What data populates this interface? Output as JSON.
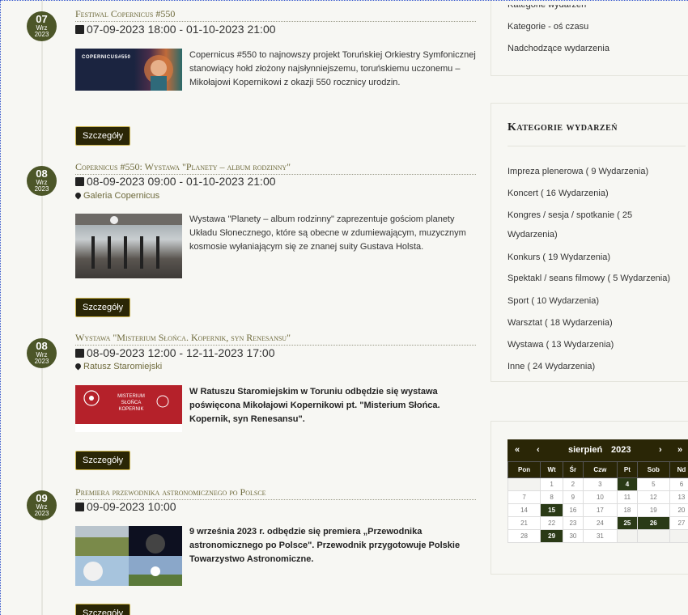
{
  "events": [
    {
      "day": "07",
      "month": "Wrz",
      "year": "2023",
      "title": "Festiwal Copernicus #550",
      "date": "07-09-2023  18:00 - 01-10-2023  21:00",
      "location": "",
      "description": "Copernicus #550 to najnowszy projekt Toruńskiej Orkiestry Symfonicznej stanowiący hołd złożony najsłynniejszemu, toruńskiemu uczonemu – Mikołajowi Kopernikowi z okazji 550 rocznicy urodzin.",
      "thumb_text": "COPERNICUS#550",
      "details_label": "Szczegóły"
    },
    {
      "day": "08",
      "month": "Wrz",
      "year": "2023",
      "title": "Copernicus #550: Wystawa \"Planety – album rodzinny\"",
      "date": "08-09-2023  09:00 - 01-10-2023  21:00",
      "location": "Galeria Copernicus",
      "description": "Wystawa \"Planety – album rodzinny\" zaprezentuje gościom planety Układu Słonecznego, które są obecne w zdumiewającym, muzycznym kosmosie wyłaniającym się ze znanej suity Gustava Holsta.",
      "details_label": "Szczegóły"
    },
    {
      "day": "08",
      "month": "Wrz",
      "year": "2023",
      "title": "Wystawa \"Misterium Słońca. Kopernik, syn Renesansu\"",
      "date": "08-09-2023  12:00 - 12-11-2023  17:00",
      "location": "Ratusz Staromiejski",
      "description": "W Ratuszu Staromiejskim w Toruniu odbędzie się wystawa poświęcona Mikołajowi Kopernikowi pt. \"Misterium Słońca. Kopernik, syn Renesansu\".",
      "thumb_text": "MISTERIUM SŁOŃCA KOPERNIK",
      "details_label": "Szczegóły"
    },
    {
      "day": "09",
      "month": "Wrz",
      "year": "2023",
      "title": "Premiera przewodnika astronomicznego po Polsce",
      "date": "09-09-2023  10:00",
      "location": "",
      "description": "9 września 2023 r. odbędzie się premiera „Przewodnika astronomicznego po Polsce\". Przewodnik przygotowuje Polskie Towarzystwo Astronomiczne.",
      "details_label": "Szczegóły"
    }
  ],
  "sidebar": {
    "top_links": [
      "Kategorie wydarzeń",
      "Kategorie - oś czasu",
      "Nadchodzące wydarzenia"
    ],
    "categories_title": "Kategorie wydarzeń",
    "categories": [
      "Impreza plenerowa ( 9 Wydarzenia)",
      "Koncert ( 16 Wydarzenia)",
      "Kongres / sesja / spotkanie ( 25",
      "Wydarzenia)",
      "Konkurs ( 19 Wydarzenia)",
      "Spektakl / seans filmowy ( 5 Wydarzenia)",
      "Sport ( 10 Wydarzenia)",
      "Warsztat ( 18 Wydarzenia)",
      "Wystawa ( 13 Wydarzenia)",
      "Inne ( 24 Wydarzenia)"
    ]
  },
  "calendar": {
    "prev_year": "«",
    "prev_month": "‹",
    "month": "sierpień",
    "year": "2023",
    "next_month": "›",
    "next_year": "»",
    "weekdays": [
      "Pon",
      "Wt",
      "Śr",
      "Czw",
      "Pt",
      "Sob",
      "Nd"
    ],
    "weeks": [
      [
        "",
        "1",
        "2",
        "3",
        "4",
        "5",
        "6"
      ],
      [
        "7",
        "8",
        "9",
        "10",
        "11",
        "12",
        "13"
      ],
      [
        "14",
        "15",
        "16",
        "17",
        "18",
        "19",
        "20"
      ],
      [
        "21",
        "22",
        "23",
        "24",
        "25",
        "26",
        "27"
      ],
      [
        "28",
        "29",
        "30",
        "31",
        "",
        "",
        ""
      ]
    ],
    "event_days": [
      "4",
      "15",
      "25",
      "26",
      "29"
    ]
  },
  "colors": {
    "accent": "#4c5628",
    "dark": "#2a2606",
    "title": "#6e6a3c"
  }
}
